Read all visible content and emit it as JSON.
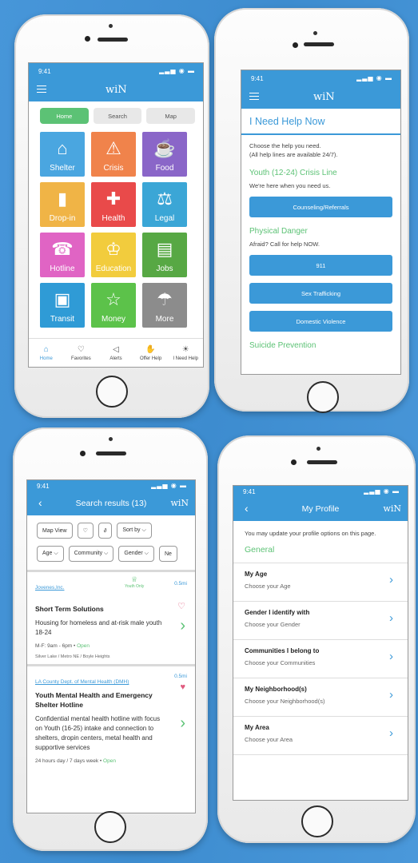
{
  "common": {
    "time": "9:41",
    "logo": "wiN",
    "signal": "▂▃▅ ◉ ▬"
  },
  "home": {
    "tabs": [
      "Home",
      "Search",
      "Map"
    ],
    "tiles": [
      {
        "label": "Shelter",
        "color": "#4aa6e0",
        "icon": "bed-icon",
        "glyph": "⌂"
      },
      {
        "label": "Crisis",
        "color": "#f0834b",
        "icon": "warning-icon",
        "glyph": "⚠"
      },
      {
        "label": "Food",
        "color": "#8a66c8",
        "icon": "coffee-cup-icon",
        "glyph": "☕"
      },
      {
        "label": "Drop-in",
        "color": "#f0b446",
        "icon": "door-icon",
        "glyph": "▮"
      },
      {
        "label": "Health",
        "color": "#e94a4a",
        "icon": "first-aid-kit-icon",
        "glyph": "✚"
      },
      {
        "label": "Legal",
        "color": "#3ba6d6",
        "icon": "scales-icon",
        "glyph": "⚖"
      },
      {
        "label": "Hotline",
        "color": "#e064c4",
        "icon": "phone-icon",
        "glyph": "☎"
      },
      {
        "label": "Education",
        "color": "#f2cc3d",
        "icon": "graduation-cap-icon",
        "glyph": "♔"
      },
      {
        "label": "Jobs",
        "color": "#57a844",
        "icon": "hire-me-sign-icon",
        "glyph": "▤"
      },
      {
        "label": "Transit",
        "color": "#2f9bd6",
        "icon": "bus-icon",
        "glyph": "▣"
      },
      {
        "label": "Money",
        "color": "#5cc24a",
        "icon": "money-star-icon",
        "glyph": "☆"
      },
      {
        "label": "More",
        "color": "#8c8c8c",
        "icon": "shower-icon",
        "glyph": "☂"
      }
    ],
    "nav": [
      {
        "label": "Home",
        "icon": "home-icon",
        "glyph": "⌂"
      },
      {
        "label": "Favorites",
        "icon": "heart-icon",
        "glyph": "♡"
      },
      {
        "label": "Alerts",
        "icon": "megaphone-icon",
        "glyph": "◁"
      },
      {
        "label": "Offer Help",
        "icon": "helping-hand-icon",
        "glyph": "✋"
      },
      {
        "label": "I Need Help",
        "icon": "alert-light-icon",
        "glyph": "☀"
      }
    ]
  },
  "help": {
    "title": "I Need Help Now",
    "intro1": "Choose the help you need.",
    "intro2": "(All help lines are available 24/7).",
    "youth_heading": "Youth (12-24) Crisis Line",
    "youth_text": "We're here when you need us.",
    "counseling": "Counseling/Referrals",
    "danger_heading": "Physical Danger",
    "danger_text": "Afraid? Call for help NOW.",
    "btn_911": "911",
    "btn_traffic": "Sex Trafficking",
    "btn_dv": "Domestic Violence",
    "suicide_heading": "Suicide Prevention"
  },
  "search": {
    "title": "Search results (13)",
    "chips1": [
      "Map View",
      "♡",
      "∂",
      "Sort by ⌵"
    ],
    "chips2": [
      "Age ⌵",
      "Community ⌵",
      "Gender ⌵",
      "Ne"
    ],
    "results": [
      {
        "org": "Jovenes,Inc.",
        "tag": "Youth Only",
        "dist": "0.5mi",
        "title": "Short Term Solutions",
        "desc": "Housing for homeless and at-risk male youth 18-24",
        "hours": "M-F: 9am - 6pm  •",
        "open": "Open",
        "loc": "Silver Lake / Metro NE / Boyle Heights"
      },
      {
        "org": "LA County Dept. of Mental  Health (DMH)",
        "dist": "0.5mi",
        "title": "Youth Mental Health and Emergency Shelter Hotline",
        "desc": "Confidential mental health hotline with focus on Youth (16-25) intake and connection to shelters, dropin centers, metal health and supportive services",
        "hours": "24 hours day / 7 days week  •",
        "open": "Open"
      }
    ]
  },
  "profile": {
    "title": "My Profile",
    "intro": "You may update your profile options on this page.",
    "section": "General",
    "rows": [
      {
        "title": "My Age",
        "sub": "Choose your Age"
      },
      {
        "title": "Gender I identify with",
        "sub": "Choose your Gender"
      },
      {
        "title": "Communities I belong to",
        "sub": "Choose your Communities"
      },
      {
        "title": "My Neighborhood(s)",
        "sub": "Choose your Neighborhood(s)"
      },
      {
        "title": "My Area",
        "sub": "Choose your Area"
      }
    ]
  }
}
